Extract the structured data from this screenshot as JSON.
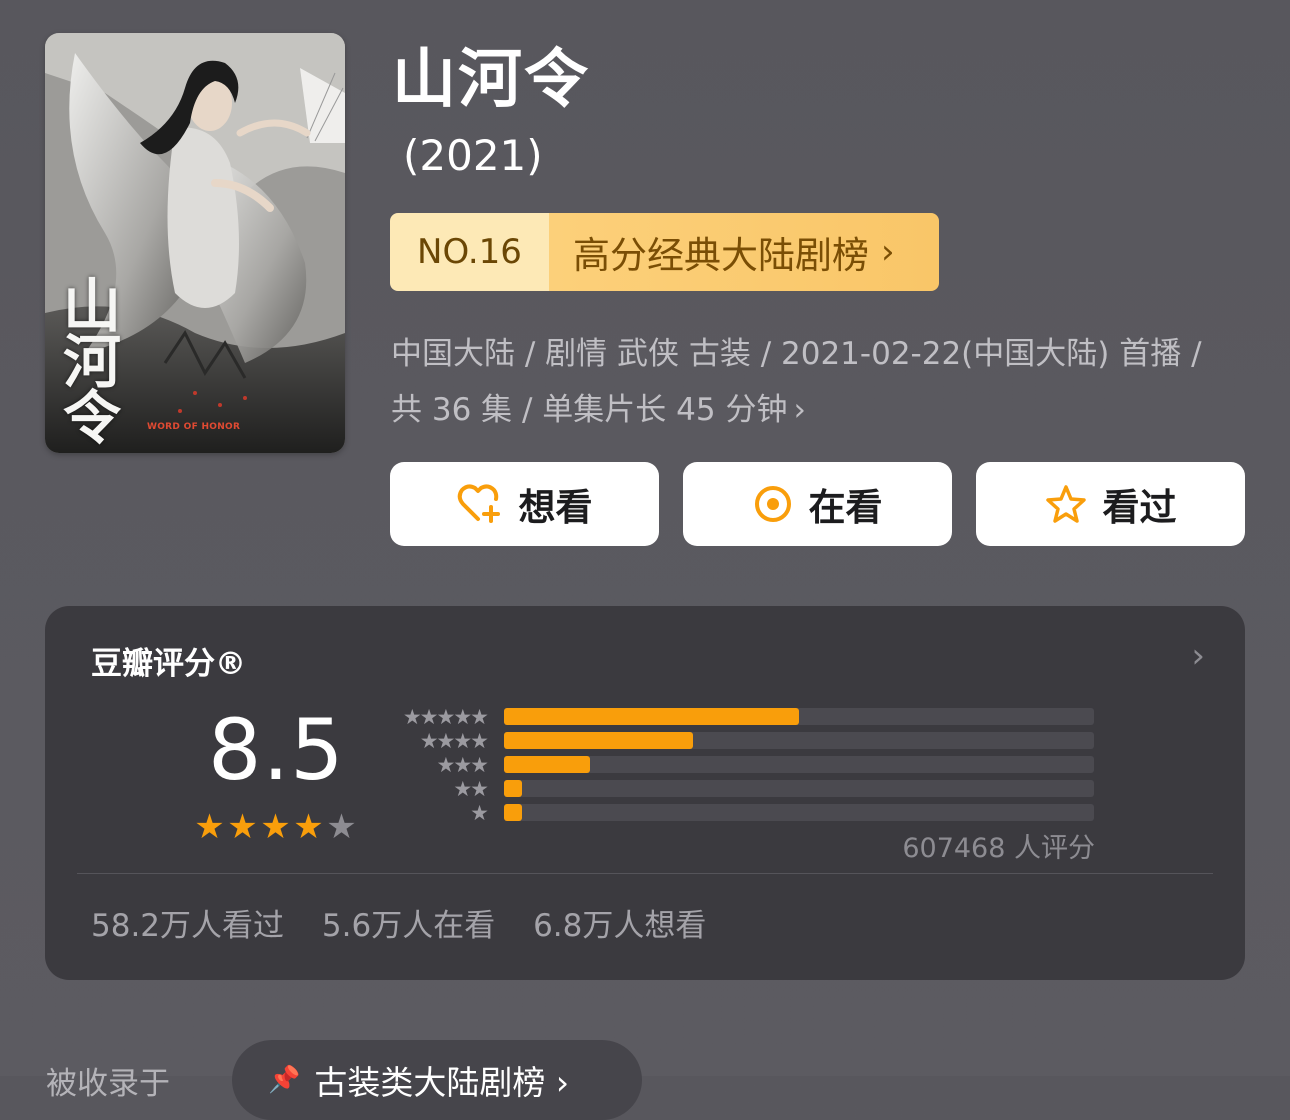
{
  "poster": {
    "title_chars": [
      "山",
      "河",
      "令"
    ],
    "logo_text": "WORD OF HONOR"
  },
  "title": "山河令",
  "year": "(2021)",
  "rank": {
    "number": "NO.16",
    "list_name": "高分经典大陆剧榜",
    "chevron": "›"
  },
  "meta": {
    "line1": "中国大陆 / 剧情 武侠 古装 / 2021-02-22(中国大陆) 首播 /",
    "line2": "共 36 集 / 单集片长 45 分钟",
    "chevron": "›"
  },
  "actions": {
    "want": "想看",
    "doing": "在看",
    "done": "看过"
  },
  "colors": {
    "accent": "#f99e0b",
    "badge_light": "#fde9b6",
    "badge_dark": "#fcd07a",
    "card_bg": "#3b3a3f"
  },
  "rating": {
    "label": "豆瓣评分®",
    "chevron": "›",
    "score": "8.5",
    "star_count": 5,
    "stars_filled": 4,
    "distribution": [
      {
        "stars": "★★★★★",
        "fraction": 0.5
      },
      {
        "stars": "★★★★",
        "fraction": 0.32
      },
      {
        "stars": "★★★",
        "fraction": 0.145
      },
      {
        "stars": "★★",
        "fraction": 0.03
      },
      {
        "stars": "★",
        "fraction": 0.03
      }
    ],
    "count_text": "607468 人评分"
  },
  "stats": {
    "watched": "58.2万人看过",
    "watching": "5.6万人在看",
    "want": "6.8万人想看"
  },
  "bottom": {
    "label": "被收录于",
    "pill_icon": "pin-icon",
    "pill_text": "古装类大陆剧榜 ›"
  }
}
